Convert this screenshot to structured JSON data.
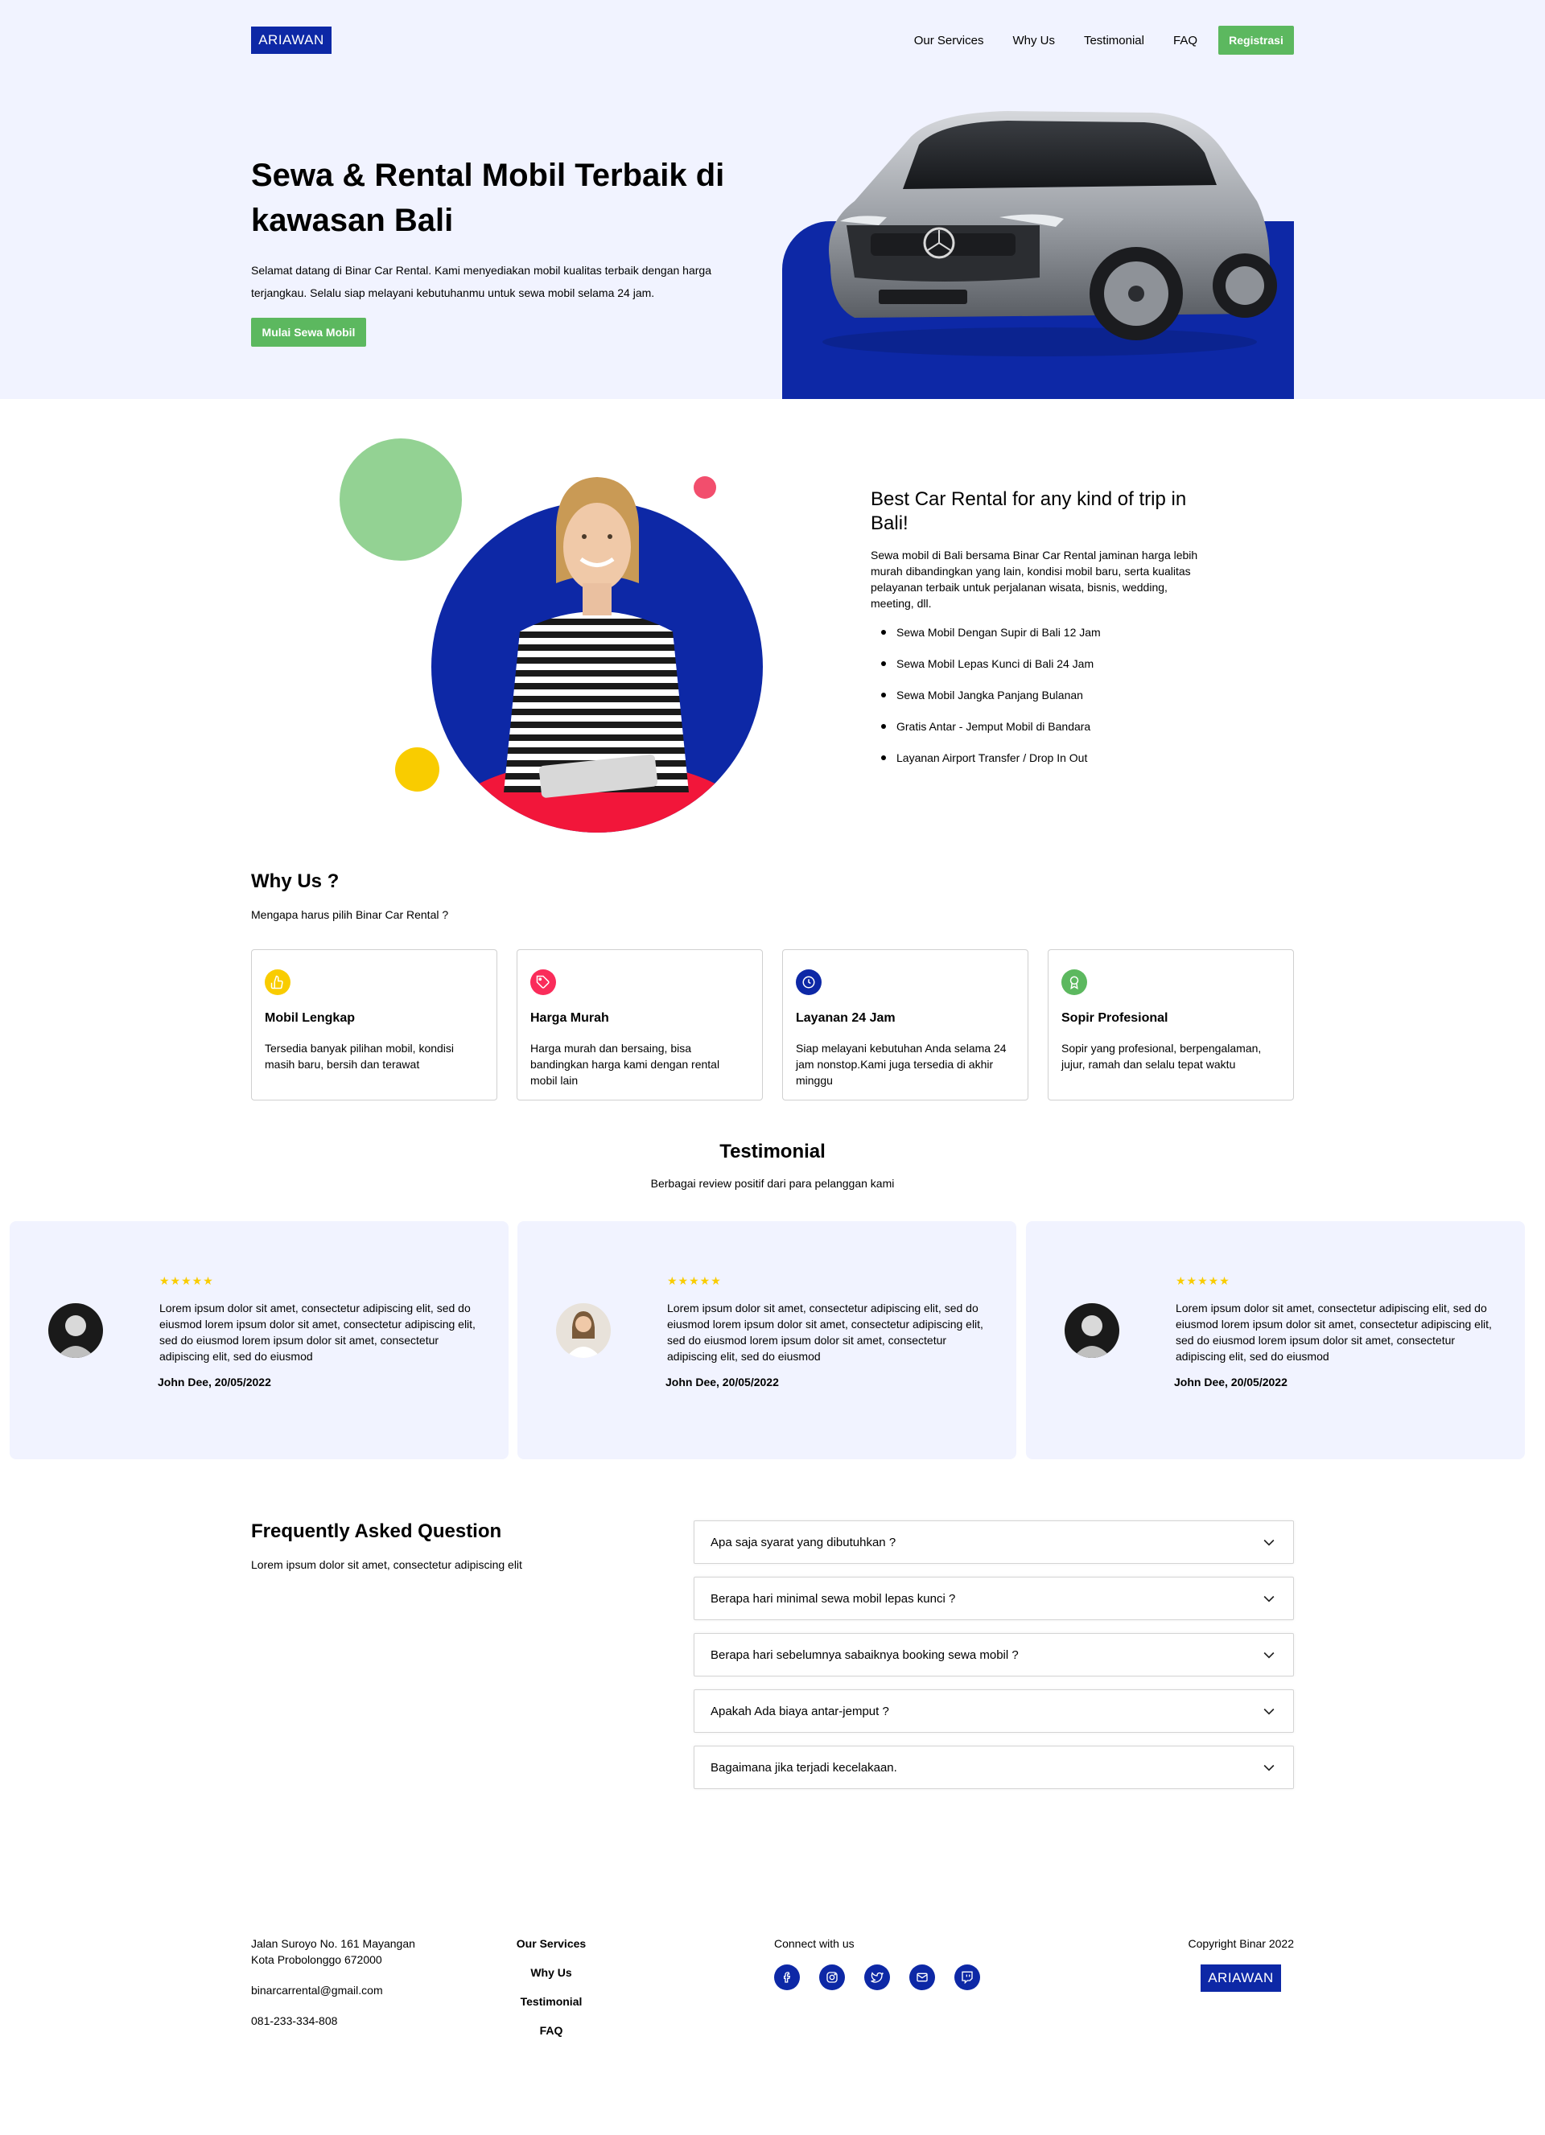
{
  "brand": {
    "logo": "ARIAWAN",
    "accent": "#0D28A6",
    "green": "#5CB85F",
    "hero_bg": "#F1F3FF"
  },
  "nav": {
    "items": [
      "Our Services",
      "Why Us",
      "Testimonial",
      "FAQ"
    ],
    "cta": "Registrasi"
  },
  "hero": {
    "title": "Sewa & Rental Mobil Terbaik di kawasan Bali",
    "text": "Selamat datang di Binar Car Rental. Kami menyediakan mobil kualitas terbaik dengan harga terjangkau. Selalu siap melayani kebutuhanmu untuk sewa mobil selama 24 jam.",
    "cta": "Mulai Sewa Mobil"
  },
  "services": {
    "title": "Best Car Rental for any kind of trip in Bali!",
    "text": "Sewa mobil di Bali bersama Binar Car Rental jaminan harga lebih murah dibandingkan yang lain, kondisi mobil baru, serta kualitas pelayanan terbaik untuk perjalanan wisata, bisnis, wedding, meeting, dll.",
    "list": [
      "Sewa Mobil Dengan Supir di Bali 12 Jam",
      "Sewa Mobil Lepas Kunci di Bali 24 Jam",
      "Sewa Mobil Jangka Panjang Bulanan",
      "Gratis Antar - Jemput Mobil di Bandara",
      "Layanan Airport Transfer / Drop In Out"
    ]
  },
  "why": {
    "title": "Why Us ?",
    "subtitle": "Mengapa harus pilih Binar Car Rental ?",
    "cards": [
      {
        "icon": "thumbs-up-icon",
        "color": "#F9CC00",
        "title": "Mobil Lengkap",
        "text": "Tersedia banyak pilihan mobil, kondisi masih baru, bersih dan terawat"
      },
      {
        "icon": "price-tag-icon",
        "color": "#FA2C5A",
        "title": "Harga Murah",
        "text": "Harga murah dan bersaing, bisa bandingkan harga kami dengan rental mobil lain"
      },
      {
        "icon": "clock-icon",
        "color": "#0D28A6",
        "title": "Layanan 24 Jam",
        "text": "Siap melayani kebutuhan Anda selama 24 jam nonstop.Kami juga tersedia di akhir minggu"
      },
      {
        "icon": "award-icon",
        "color": "#5CB85F",
        "title": "Sopir Profesional",
        "text": "Sopir yang profesional, berpengalaman, jujur, ramah dan selalu tepat waktu"
      }
    ]
  },
  "testimonial": {
    "title": "Testimonial",
    "subtitle": "Berbagai review positif dari para pelanggan kami",
    "items": [
      {
        "stars": "★★★★★",
        "quote": "Lorem ipsum dolor sit amet, consectetur adipiscing elit, sed do eiusmod lorem ipsum dolor sit amet, consectetur adipiscing elit, sed do eiusmod lorem ipsum dolor sit amet, consectetur adipiscing elit, sed do eiusmod",
        "author": "John Dee, 20/05/2022"
      },
      {
        "stars": "★★★★★",
        "quote": "Lorem ipsum dolor sit amet, consectetur adipiscing elit, sed do eiusmod lorem ipsum dolor sit amet, consectetur adipiscing elit, sed do eiusmod lorem ipsum dolor sit amet, consectetur adipiscing elit, sed do eiusmod",
        "author": "John Dee, 20/05/2022"
      },
      {
        "stars": "★★★★★",
        "quote": "Lorem ipsum dolor sit amet, consectetur adipiscing elit, sed do eiusmod lorem ipsum dolor sit amet, consectetur adipiscing elit, sed do eiusmod lorem ipsum dolor sit amet, consectetur adipiscing elit, sed do eiusmod",
        "author": "John Dee, 20/05/2022"
      }
    ]
  },
  "faq": {
    "title": "Frequently Asked Question",
    "subtitle": "Lorem ipsum dolor sit amet, consectetur adipiscing elit",
    "items": [
      "Apa saja syarat yang dibutuhkan ?",
      "Berapa hari minimal sewa mobil lepas kunci ?",
      "Berapa hari sebelumnya sabaiknya booking sewa mobil ?",
      "Apakah Ada biaya antar-jemput ?",
      "Bagaimana jika terjadi kecelakaan."
    ]
  },
  "footer": {
    "address": "Jalan Suroyo No. 161 Mayangan Kota Probolonggo 672000",
    "email": "binarcarrental@gmail.com",
    "phone": "081-233-334-808",
    "nav": [
      "Our Services",
      "Why Us",
      "Testimonial",
      "FAQ"
    ],
    "connect": "Connect with us",
    "socials": [
      "facebook-icon",
      "instagram-icon",
      "twitter-icon",
      "mail-icon",
      "twitch-icon"
    ],
    "copyright": "Copyright Binar 2022",
    "logo": "ARIAWAN"
  }
}
